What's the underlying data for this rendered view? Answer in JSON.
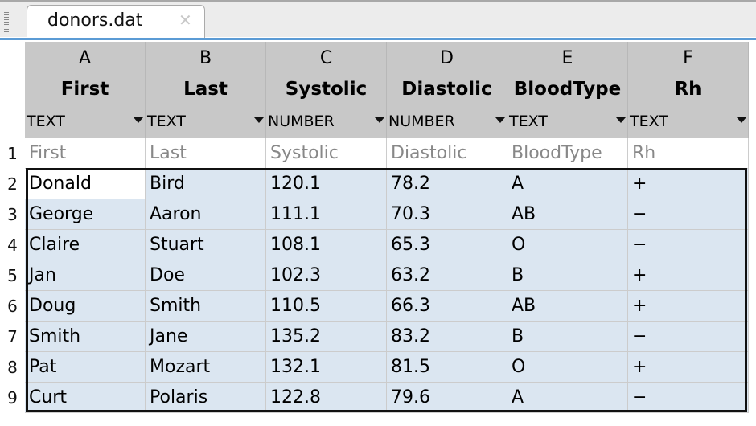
{
  "tab": {
    "title": "donors.dat"
  },
  "columns": [
    {
      "letter": "A",
      "name": "First",
      "type": "TEXT"
    },
    {
      "letter": "B",
      "name": "Last",
      "type": "TEXT"
    },
    {
      "letter": "C",
      "name": "Systolic",
      "type": "NUMBER"
    },
    {
      "letter": "D",
      "name": "Diastolic",
      "type": "NUMBER"
    },
    {
      "letter": "E",
      "name": "BloodType",
      "type": "TEXT"
    },
    {
      "letter": "F",
      "name": "Rh",
      "type": "TEXT"
    }
  ],
  "rows": [
    {
      "n": "1",
      "cells": [
        "First",
        "Last",
        "Systolic",
        "Diastolic",
        "BloodType",
        "Rh"
      ]
    },
    {
      "n": "2",
      "cells": [
        "Donald",
        "Bird",
        "120.1",
        "78.2",
        "A",
        "+"
      ]
    },
    {
      "n": "3",
      "cells": [
        "George",
        "Aaron",
        "111.1",
        "70.3",
        "AB",
        "−"
      ]
    },
    {
      "n": "4",
      "cells": [
        "Claire",
        "Stuart",
        "108.1",
        "65.3",
        "O",
        "−"
      ]
    },
    {
      "n": "5",
      "cells": [
        "Jan",
        "Doe",
        "102.3",
        "63.2",
        "B",
        "+"
      ]
    },
    {
      "n": "6",
      "cells": [
        "Doug",
        "Smith",
        "110.5",
        "66.3",
        "AB",
        "+"
      ]
    },
    {
      "n": "7",
      "cells": [
        "Smith",
        "Jane",
        "135.2",
        "83.2",
        "B",
        "−"
      ]
    },
    {
      "n": "8",
      "cells": [
        "Pat",
        "Mozart",
        "132.1",
        "81.5",
        "O",
        "+"
      ]
    },
    {
      "n": "9",
      "cells": [
        "Curt",
        "Polaris",
        "122.8",
        "79.6",
        "A",
        "−"
      ]
    }
  ]
}
